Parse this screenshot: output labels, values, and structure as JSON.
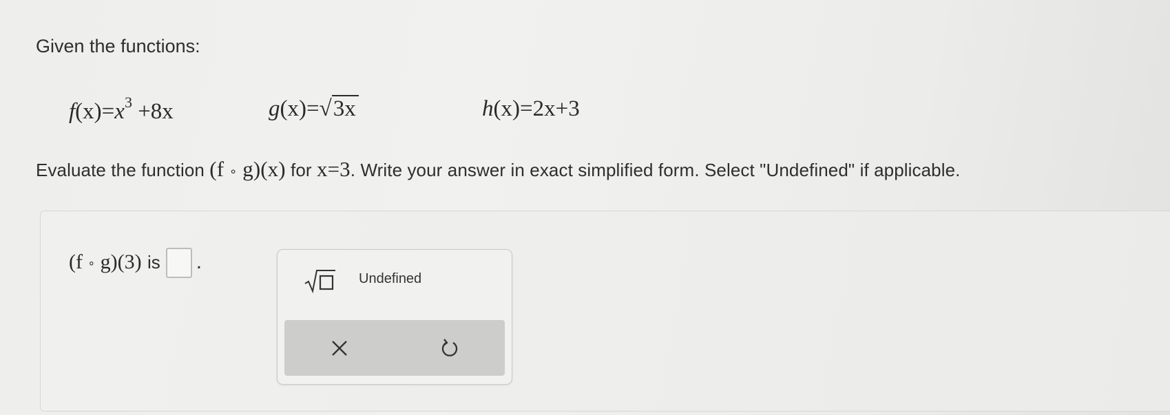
{
  "prompt": "Given the functions:",
  "functions": {
    "f": {
      "name": "f",
      "arg": "(x)",
      "eq": "=",
      "base": "x",
      "exp": "3",
      "rest": " +8x"
    },
    "g": {
      "name": "g",
      "arg": "(x)",
      "eq": "=",
      "radicand": "3x"
    },
    "h": {
      "name": "h",
      "arg": "(x)",
      "eq": "=",
      "expr": "2x+3"
    }
  },
  "instruction": {
    "before": "Evaluate the function ",
    "expr_open": "(f",
    "op": "∘",
    "expr_close": "g)(x)",
    "mid": " for ",
    "condition": "x=3",
    "after": ". Write your answer in exact simplified form. Select \"Undefined\" if applicable."
  },
  "answer": {
    "lhs_open": "(f",
    "op": "∘",
    "lhs_close": "g)(3)",
    "is": "is",
    "period": "."
  },
  "palette": {
    "sqrt_icon": "square-root-template-icon",
    "undefined_label": "Undefined",
    "clear_icon": "close-icon",
    "undo_icon": "undo-icon"
  }
}
